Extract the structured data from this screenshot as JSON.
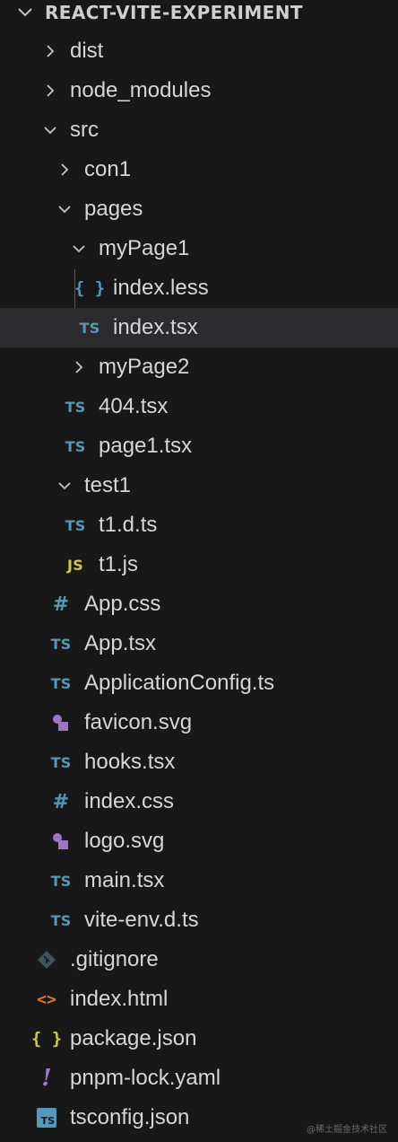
{
  "explorer": {
    "root_label": "REACT-VITE-EXPERIMENT",
    "items": [
      {
        "label": "dist",
        "kind": "folder",
        "expanded": false,
        "depth": 1,
        "icon": "chevron-right-icon"
      },
      {
        "label": "node_modules",
        "kind": "folder",
        "expanded": false,
        "depth": 1,
        "icon": "chevron-right-icon"
      },
      {
        "label": "src",
        "kind": "folder",
        "expanded": true,
        "depth": 1,
        "icon": "chevron-down-icon"
      },
      {
        "label": "con1",
        "kind": "folder",
        "expanded": false,
        "depth": 2,
        "icon": "chevron-right-icon"
      },
      {
        "label": "pages",
        "kind": "folder",
        "expanded": true,
        "depth": 2,
        "icon": "chevron-down-icon"
      },
      {
        "label": "myPage1",
        "kind": "folder",
        "expanded": true,
        "depth": 3,
        "icon": "chevron-down-icon"
      },
      {
        "label": "index.less",
        "kind": "file",
        "depth": 4,
        "icon": "less-braces-icon",
        "icon_text": "{ }"
      },
      {
        "label": "index.tsx",
        "kind": "file",
        "depth": 4,
        "icon": "typescript-icon",
        "icon_text": "TS",
        "selected": true
      },
      {
        "label": "myPage2",
        "kind": "folder",
        "expanded": false,
        "depth": 3,
        "icon": "chevron-right-icon"
      },
      {
        "label": "404.tsx",
        "kind": "file",
        "depth": 3,
        "icon": "typescript-icon",
        "icon_text": "TS"
      },
      {
        "label": "page1.tsx",
        "kind": "file",
        "depth": 3,
        "icon": "typescript-icon",
        "icon_text": "TS"
      },
      {
        "label": "test1",
        "kind": "folder",
        "expanded": true,
        "depth": 2,
        "icon": "chevron-down-icon"
      },
      {
        "label": "t1.d.ts",
        "kind": "file",
        "depth": 3,
        "icon": "typescript-icon",
        "icon_text": "TS"
      },
      {
        "label": "t1.js",
        "kind": "file",
        "depth": 3,
        "icon": "javascript-icon",
        "icon_text": "JS"
      },
      {
        "label": "App.css",
        "kind": "file",
        "depth": 2,
        "icon": "css-hash-icon",
        "icon_text": "#"
      },
      {
        "label": "App.tsx",
        "kind": "file",
        "depth": 2,
        "icon": "typescript-icon",
        "icon_text": "TS"
      },
      {
        "label": "ApplicationConfig.ts",
        "kind": "file",
        "depth": 2,
        "icon": "typescript-icon",
        "icon_text": "TS"
      },
      {
        "label": "favicon.svg",
        "kind": "file",
        "depth": 2,
        "icon": "svg-shapes-icon"
      },
      {
        "label": "hooks.tsx",
        "kind": "file",
        "depth": 2,
        "icon": "typescript-icon",
        "icon_text": "TS"
      },
      {
        "label": "index.css",
        "kind": "file",
        "depth": 2,
        "icon": "css-hash-icon",
        "icon_text": "#"
      },
      {
        "label": "logo.svg",
        "kind": "file",
        "depth": 2,
        "icon": "svg-shapes-icon"
      },
      {
        "label": "main.tsx",
        "kind": "file",
        "depth": 2,
        "icon": "typescript-icon",
        "icon_text": "TS"
      },
      {
        "label": "vite-env.d.ts",
        "kind": "file",
        "depth": 2,
        "icon": "typescript-icon",
        "icon_text": "TS"
      },
      {
        "label": ".gitignore",
        "kind": "file",
        "depth": 1,
        "icon": "git-diamond-icon"
      },
      {
        "label": "index.html",
        "kind": "file",
        "depth": 1,
        "icon": "html-brackets-icon",
        "icon_text": "<>"
      },
      {
        "label": "package.json",
        "kind": "file",
        "depth": 1,
        "icon": "json-braces-icon",
        "icon_text": "{ }"
      },
      {
        "label": "pnpm-lock.yaml",
        "kind": "file",
        "depth": 1,
        "icon": "yaml-exclamation-icon",
        "icon_text": "!"
      },
      {
        "label": "tsconfig.json",
        "kind": "file",
        "depth": 1,
        "icon": "tsconfig-icon",
        "icon_text": "TS"
      }
    ]
  },
  "watermark": "@稀土掘金技术社区",
  "colors": {
    "background": "#181818",
    "selected_row": "#2c2c2f",
    "text": "#d6d6d6",
    "typescript": "#519aba",
    "javascript": "#cbcb41",
    "css": "#519aba",
    "less": "#519aba",
    "json": "#cbcb41",
    "svg": "#a074c4",
    "html": "#e37933",
    "yaml": "#a074c4",
    "git": "#41535b"
  }
}
